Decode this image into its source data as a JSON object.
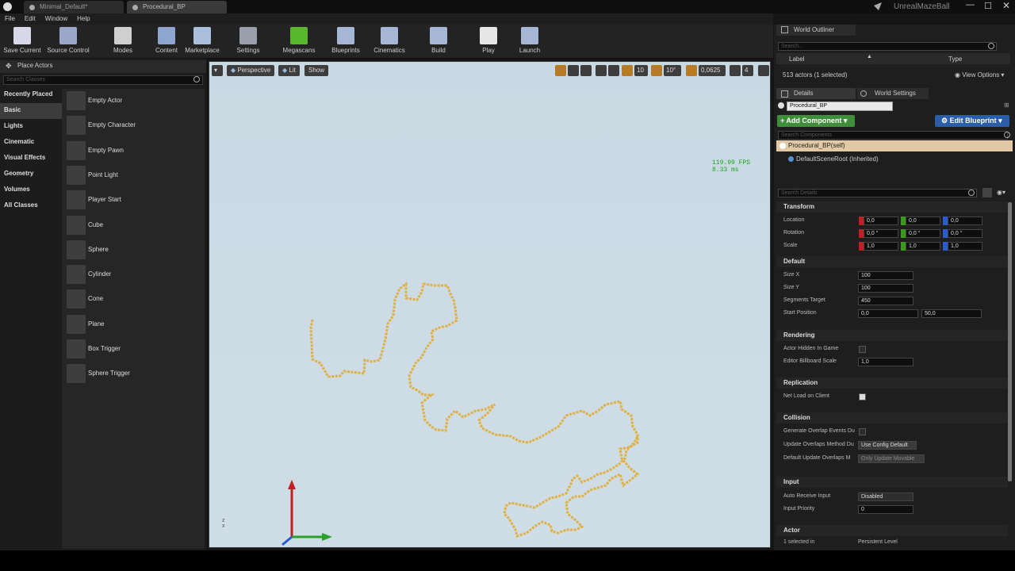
{
  "titlebar": {
    "tabs": [
      "Minimal_Default*",
      "Procedural_BP"
    ],
    "project": "UnrealMazeBall"
  },
  "menu": [
    "File",
    "Edit",
    "Window",
    "Help"
  ],
  "toolbar": [
    {
      "label": "Save Current",
      "icon": "save-icon",
      "color": "#d8d8e8"
    },
    {
      "label": "Source Control",
      "icon": "source-control-icon",
      "color": "#9aa7c8"
    },
    {
      "label": "Modes",
      "icon": "modes-icon",
      "color": "#cfcfcf"
    },
    {
      "label": "Content",
      "icon": "content-icon",
      "color": "#8ea6cf"
    },
    {
      "label": "Marketplace",
      "icon": "marketplace-icon",
      "color": "#a9bfdc"
    },
    {
      "label": "Settings",
      "icon": "settings-icon",
      "color": "#9aa0ab"
    },
    {
      "label": "Megascans",
      "icon": "megascans-icon",
      "color": "#59b72b"
    },
    {
      "label": "Blueprints",
      "icon": "blueprints-icon",
      "color": "#a6b7d6"
    },
    {
      "label": "Cinematics",
      "icon": "cinematics-icon",
      "color": "#a6b7d6"
    },
    {
      "label": "Build",
      "icon": "build-icon",
      "color": "#a6b7d6"
    },
    {
      "label": "Play",
      "icon": "play-icon",
      "color": "#e6e6e6"
    },
    {
      "label": "Launch",
      "icon": "launch-icon",
      "color": "#a6b7d6"
    }
  ],
  "place_actors": {
    "title": "Place Actors",
    "search_placeholder": "Search Classes",
    "categories": [
      "Recently Placed",
      "Basic",
      "Lights",
      "Cinematic",
      "Visual Effects",
      "Geometry",
      "Volumes",
      "All Classes"
    ],
    "selected_category": "Basic",
    "actors": [
      "Empty Actor",
      "Empty Character",
      "Empty Pawn",
      "Point Light",
      "Player Start",
      "Cube",
      "Sphere",
      "Cylinder",
      "Cone",
      "Plane",
      "Box Trigger",
      "Sphere Trigger"
    ]
  },
  "viewport": {
    "buttons": [
      "Perspective",
      "Lit",
      "Show"
    ],
    "snap_angle": "10°",
    "snap_scale": "0,0625",
    "camera_speed": "4",
    "fps": "119.99 FPS",
    "ms": "8.33 ms",
    "accent": "#e0b040"
  },
  "outliner": {
    "title": "World Outliner",
    "search_placeholder": "Search...",
    "col_label": "Label",
    "col_type": "Type",
    "count": "513 actors (1 selected)",
    "view_options": "View Options"
  },
  "details": {
    "tab_details": "Details",
    "tab_world": "World Settings",
    "actor_name": "Procedural_BP",
    "add_component": "+ Add Component",
    "edit_blueprint": "Edit Blueprint",
    "search_components": "Search Components",
    "self": "Procedural_BP(self)",
    "root": "DefaultSceneRoot (Inherited)",
    "search_details": "Search Details",
    "sections": {
      "transform": "Transform",
      "default": "Default",
      "rendering": "Rendering",
      "replication": "Replication",
      "collision": "Collision",
      "input": "Input",
      "actor": "Actor"
    },
    "location": {
      "label": "Location",
      "x": "0,0",
      "y": "0,0",
      "z": "0,0"
    },
    "rotation": {
      "label": "Rotation",
      "x": "0,0 °",
      "y": "0,0 °",
      "z": "0,0 °"
    },
    "scale": {
      "label": "Scale",
      "x": "1,0",
      "y": "1,0",
      "z": "1,0"
    },
    "size_x": {
      "label": "Size X",
      "value": "100"
    },
    "size_y": {
      "label": "Size Y",
      "value": "100"
    },
    "segments": {
      "label": "Segments Target",
      "value": "450"
    },
    "start_pos": {
      "label": "Start Position",
      "x": "0,0",
      "y": "50,0"
    },
    "hidden": {
      "label": "Actor Hidden In Game"
    },
    "billboard": {
      "label": "Editor Billboard Scale",
      "value": "1,0"
    },
    "net_load": {
      "label": "Net Load on Client"
    },
    "gen_overlap": {
      "label": "Generate Overlap Events Du"
    },
    "upd_overlap": {
      "label": "Update Overlaps Method Du",
      "value": "Use Config Default"
    },
    "def_overlap": {
      "label": "Default Update Overlaps M",
      "value": "Only Update Movable"
    },
    "auto_input": {
      "label": "Auto Receive Input",
      "value": "Disabled"
    },
    "input_priority": {
      "label": "Input Priority",
      "value": "0"
    },
    "selected_in": {
      "label": "1 selected in",
      "value": "Persistent Level"
    }
  }
}
